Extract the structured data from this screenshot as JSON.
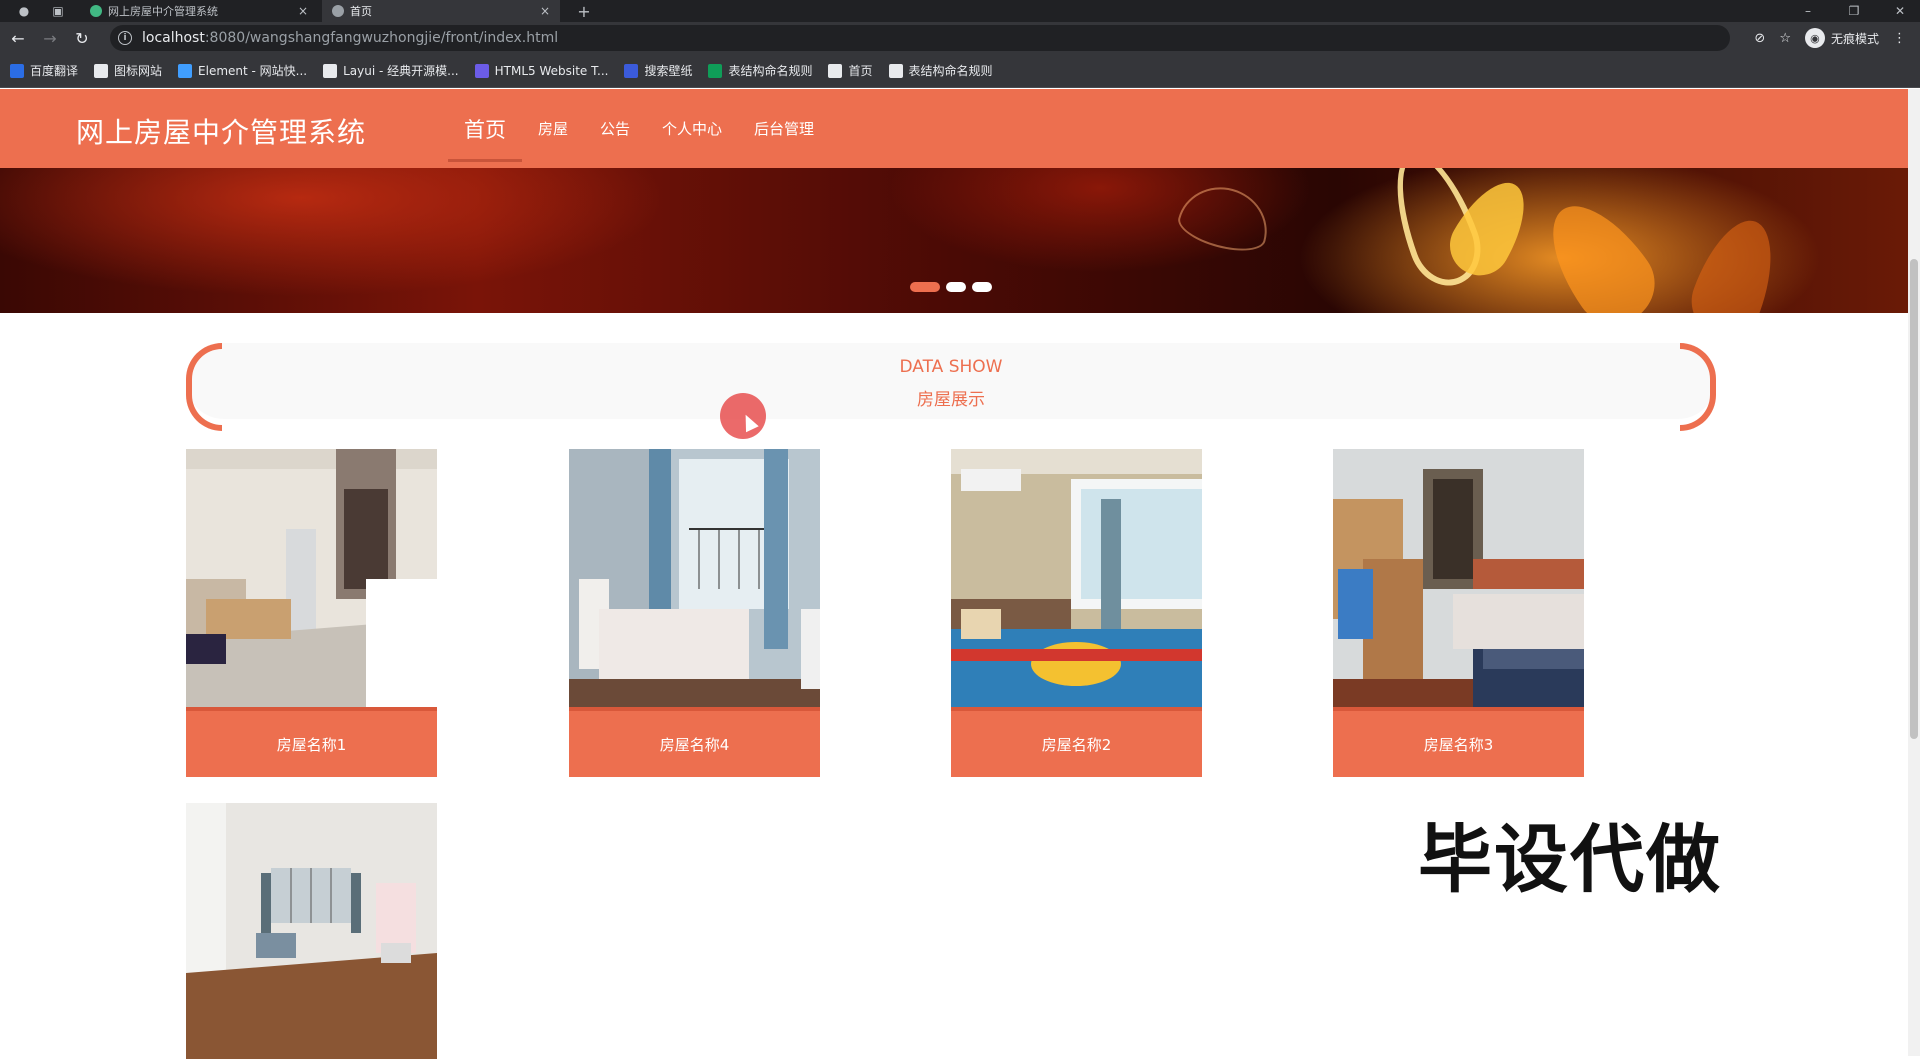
{
  "browser": {
    "tabs": [
      {
        "title": "网上房屋中介管理系统",
        "active": false
      },
      {
        "title": "首页",
        "active": true
      }
    ],
    "new_tab": "+",
    "url_host": "localhost",
    "url_path": ":8080/wangshangfangwuzhongjie/front/index.html",
    "profile_label": "无痕模式",
    "bookmarks": [
      {
        "label": "百度翻译",
        "icon": "translate-icon",
        "color": "#2b6de5"
      },
      {
        "label": "图标网站",
        "icon": "flag-icon",
        "color": "#e8eaed"
      },
      {
        "label": "Element - 网站快...",
        "icon": "element-icon",
        "color": "#409eff"
      },
      {
        "label": "Layui - 经典开源模...",
        "icon": "layui-icon",
        "color": "#e8eaed"
      },
      {
        "label": "HTML5 Website T...",
        "icon": "html5-icon",
        "color": "#6c5ce7"
      },
      {
        "label": "搜索壁纸",
        "icon": "wallpaper-icon",
        "color": "#3b5bdb"
      },
      {
        "label": "表结构命名规则",
        "icon": "sheet-icon",
        "color": "#0f9d58"
      },
      {
        "label": "首页",
        "icon": "globe-icon",
        "color": "#e8eaed"
      },
      {
        "label": "表结构命名规则",
        "icon": "globe-icon",
        "color": "#e8eaed"
      }
    ]
  },
  "site": {
    "title": "网上房屋中介管理系统",
    "nav": [
      {
        "label": "首页",
        "active": true
      },
      {
        "label": "房屋",
        "active": false
      },
      {
        "label": "公告",
        "active": false
      },
      {
        "label": "个人中心",
        "active": false
      },
      {
        "label": "后台管理",
        "active": false
      }
    ],
    "accent_color": "#ed6f4f"
  },
  "banner": {
    "slides": 3,
    "active_slide": 1
  },
  "section": {
    "title_en": "DATA SHOW",
    "title_cn": "房屋展示"
  },
  "houses": [
    {
      "name": "房屋名称1"
    },
    {
      "name": "房屋名称4"
    },
    {
      "name": "房屋名称2"
    },
    {
      "name": "房屋名称3"
    },
    {
      "name": ""
    }
  ],
  "watermark": "毕设代做"
}
